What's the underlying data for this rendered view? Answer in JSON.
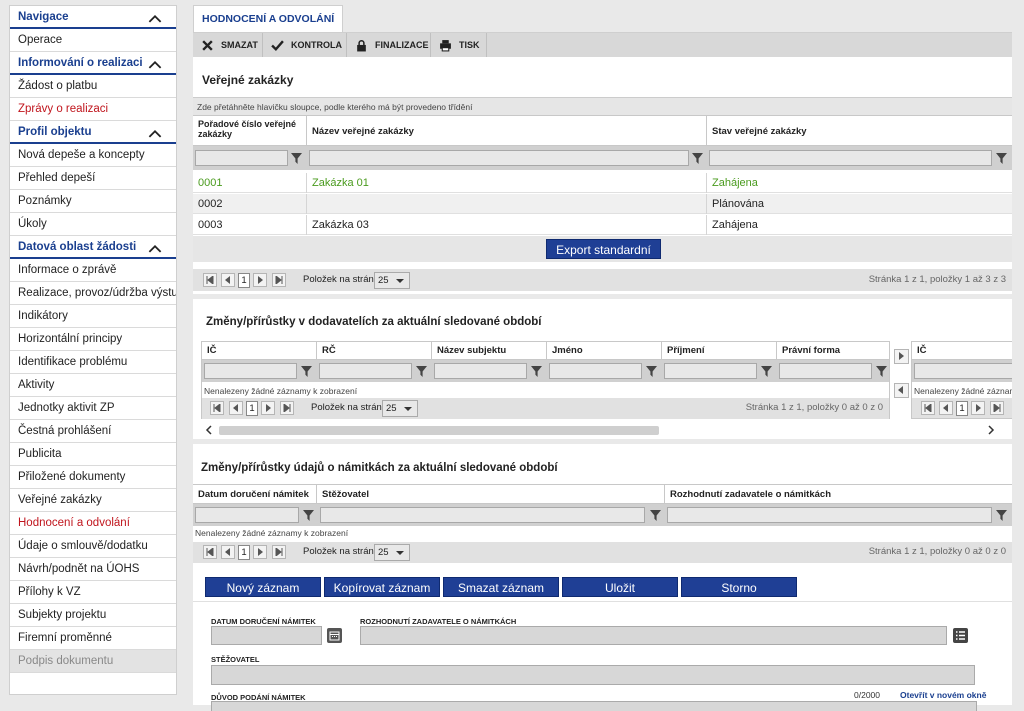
{
  "sidebar": {
    "items": [
      {
        "label": "Navigace",
        "type": "section"
      },
      {
        "label": "Operace",
        "type": "item"
      },
      {
        "label": "Informování o realizaci",
        "type": "section"
      },
      {
        "label": "Žádost o platbu",
        "type": "item"
      },
      {
        "label": "Zprávy o realizaci",
        "type": "item-red"
      },
      {
        "label": "Profil objektu",
        "type": "section"
      },
      {
        "label": "Nová depeše a koncepty",
        "type": "item"
      },
      {
        "label": "Přehled depeší",
        "type": "item"
      },
      {
        "label": "Poznámky",
        "type": "item"
      },
      {
        "label": "Úkoly",
        "type": "item"
      },
      {
        "label": "Datová oblast žádosti",
        "type": "section"
      },
      {
        "label": "Informace o zprávě",
        "type": "item"
      },
      {
        "label": "Realizace, provoz/údržba výstupu",
        "type": "item"
      },
      {
        "label": "Indikátory",
        "type": "item"
      },
      {
        "label": "Horizontální principy",
        "type": "item"
      },
      {
        "label": "Identifikace problému",
        "type": "item"
      },
      {
        "label": "Aktivity",
        "type": "item"
      },
      {
        "label": "Jednotky aktivit ZP",
        "type": "item"
      },
      {
        "label": "Čestná prohlášení",
        "type": "item"
      },
      {
        "label": "Publicita",
        "type": "item"
      },
      {
        "label": "Přiložené dokumenty",
        "type": "item"
      },
      {
        "label": "Veřejné zakázky",
        "type": "item"
      },
      {
        "label": "Hodnocení a odvolání",
        "type": "item-red"
      },
      {
        "label": "Údaje o smlouvě/dodatku",
        "type": "item"
      },
      {
        "label": "Návrh/podnět na ÚOHS",
        "type": "item"
      },
      {
        "label": "Přílohy k VZ",
        "type": "item"
      },
      {
        "label": "Subjekty projektu",
        "type": "item"
      },
      {
        "label": "Firemní proměnné",
        "type": "item"
      },
      {
        "label": "Podpis dokumentu",
        "type": "item-disabled"
      }
    ]
  },
  "tab": {
    "label": "HODNOCENÍ A ODVOLÁNÍ"
  },
  "toolbar": {
    "delete": "SMAZAT",
    "check": "KONTROLA",
    "finalize": "FINALIZACE",
    "print": "TISK"
  },
  "panel1": {
    "title": "Veřejné zakázky",
    "group_hint": "Zde přetáhněte hlavičku sloupce, podle kterého má být provedeno třídění",
    "headers": [
      "Pořadové číslo veřejné zakázky",
      "Název veřejné zakázky",
      "Stav veřejné zakázky"
    ],
    "rows": [
      {
        "c0": "0001",
        "c1": "Zakázka 01",
        "c2": "Zahájena"
      },
      {
        "c0": "0002",
        "c1": "",
        "c2": "Plánována"
      },
      {
        "c0": "0003",
        "c1": "Zakázka 03",
        "c2": "Zahájena"
      }
    ],
    "export": "Export standardní",
    "pager": {
      "page": "1",
      "per_page_label": "Položek na stránku",
      "per_page": "25",
      "info": "Stránka 1 z 1, položky 1 až 3 z 3"
    }
  },
  "panel2": {
    "title": "Změny/přírůstky v dodavatelích za aktuální sledované období",
    "headers": [
      "IČ",
      "RČ",
      "Název subjektu",
      "Jméno",
      "Příjmení",
      "Právní forma"
    ],
    "right_header": "IČ",
    "empty": "Nenalezeny žádné záznamy k zobrazení",
    "right_empty": "Nenalezeny žádné záznam",
    "pager": {
      "page": "1",
      "per_page_label": "Položek na stránku",
      "per_page": "25",
      "info": "Stránka 1 z 1, položky 0 až 0 z 0"
    },
    "right_page": "1"
  },
  "panel3": {
    "title": "Změny/přírůstky údajů o námitkách za aktuální sledované období",
    "headers": [
      "Datum doručení námitek",
      "Stěžovatel",
      "Rozhodnutí zadavatele o námitkách"
    ],
    "empty": "Nenalezeny žádné záznamy k zobrazení",
    "pager": {
      "page": "1",
      "per_page_label": "Položek na stránku",
      "per_page": "25",
      "info": "Stránka 1 z 1, položky 0 až 0 z 0"
    }
  },
  "actions": {
    "new": "Nový záznam",
    "copy": "Kopírovat záznam",
    "delete": "Smazat záznam",
    "save": "Uložit",
    "cancel": "Storno"
  },
  "form": {
    "date_label": "DATUM DORUČENÍ NÁMITEK",
    "decision_label": "ROZHODNUTÍ ZADAVATELE O NÁMITKÁCH",
    "complainant_label": "STĚŽOVATEL",
    "reason_label": "DŮVOD PODÁNÍ NÁMITEK",
    "counter": "0/2000",
    "open_window": "Otevřít v novém okně"
  },
  "colors": {
    "accent": "#1a3f8f",
    "button": "#1f3f95",
    "red": "#c0151d",
    "green": "#4a9b1e"
  }
}
